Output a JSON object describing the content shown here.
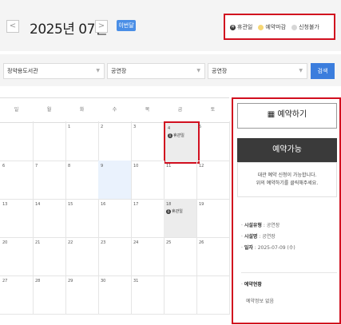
{
  "header": {
    "prev_label": "<",
    "next_label": ">",
    "month_title": "2025년 07월",
    "this_month_label": "이번달"
  },
  "legend": {
    "closed_label": "휴관일",
    "reserved_label": "예약마감",
    "unavailable_label": "신청불가",
    "closed_icon_glyph": "휴",
    "colors": {
      "closed": "#333333",
      "reserved": "#f7d774",
      "unavailable": "#d6d6d6"
    }
  },
  "filters": {
    "library": "정약용도서관",
    "facility_type": "공연장",
    "facility": "공연장",
    "search_label": "검색"
  },
  "calendar": {
    "weekdays": [
      "일",
      "월",
      "화",
      "수",
      "목",
      "금",
      "토"
    ],
    "weeks": [
      [
        "",
        "",
        "1",
        "2",
        "3",
        "4",
        "5"
      ],
      [
        "6",
        "7",
        "8",
        "9",
        "10",
        "11",
        "12"
      ],
      [
        "13",
        "14",
        "15",
        "16",
        "17",
        "18",
        "19"
      ],
      [
        "20",
        "21",
        "22",
        "23",
        "24",
        "25",
        "26"
      ],
      [
        "27",
        "28",
        "29",
        "30",
        "31",
        "",
        ""
      ]
    ],
    "closed_days": [
      "4",
      "18"
    ],
    "selected_day": "9",
    "closed_tag": "휴관일",
    "closed_icon_glyph": "휴"
  },
  "panel": {
    "reserve_label": "예약하기",
    "status_label": "예약가능",
    "note_line1": "대관 예약 신청이 가능합니다.",
    "note_line2": "위의 예약하기를 클릭해주세요.",
    "facility_type_key": "시설유형",
    "facility_type_value": "공연장",
    "facility_name_key": "시설명",
    "facility_name_value": "공연장",
    "date_key": "일자",
    "date_value": "2025-07-09 (수)",
    "status_section_title": "예약현황",
    "no_reservation": "예약정보 없음"
  }
}
